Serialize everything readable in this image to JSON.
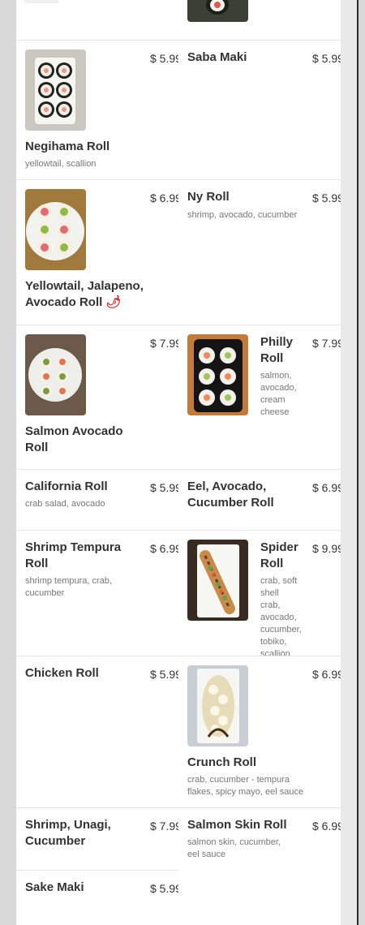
{
  "menu": {
    "items": [
      {
        "name": "Negihama Roll",
        "desc": "yellowtail, scallion",
        "price": "$ 5.99"
      },
      {
        "name": "Saba Maki",
        "desc": "",
        "price": "$ 5.99"
      },
      {
        "name": "Yellowtail, Jalapeno, Avocado Roll",
        "desc": "",
        "price": "$ 6.99",
        "spicy_icon": "chili-pepper-icon"
      },
      {
        "name": "Ny Roll",
        "desc": "shrimp, avocado, cucumber",
        "price": "$ 5.99"
      },
      {
        "name": "Salmon Avocado Roll",
        "desc": "",
        "price": "$ 7.99"
      },
      {
        "name": "Philly Roll",
        "desc": "salmon, avocado, cream cheese",
        "price": "$ 7.99"
      },
      {
        "name": "California Roll",
        "desc": "crab salad, avocado",
        "price": "$ 5.99"
      },
      {
        "name": "Eel, Avocado, Cucumber Roll",
        "desc": "",
        "price": "$ 6.99"
      },
      {
        "name": "Shrimp Tempura Roll",
        "desc": "shrimp tempura, crab, cucumber",
        "price": "$ 6.99"
      },
      {
        "name": "Spider Roll",
        "desc": "crab, soft shell crab, avocado, cucumber, tobiko, scallion",
        "price": "$ 9.99"
      },
      {
        "name": "Chicken Roll",
        "desc": "",
        "price": "$ 5.99"
      },
      {
        "name": "Crunch Roll",
        "desc": "crab, cucumber - tempura flakes, spicy mayo, eel sauce",
        "price": "$ 6.99"
      },
      {
        "name": "Shrimp, Unagi, Cucumber",
        "desc": "",
        "price": "$ 7.99"
      },
      {
        "name": "Salmon Skin Roll",
        "desc": "salmon skin, cucumber, eel sauce",
        "price": "$ 6.99"
      },
      {
        "name": "Sake Maki",
        "desc": "",
        "price": "$ 5.99"
      }
    ]
  },
  "colors": {
    "panel": "#ffffff",
    "background": "#d9d9d9",
    "text": "#333333",
    "muted": "#777777",
    "chili": "#d32f2f"
  }
}
